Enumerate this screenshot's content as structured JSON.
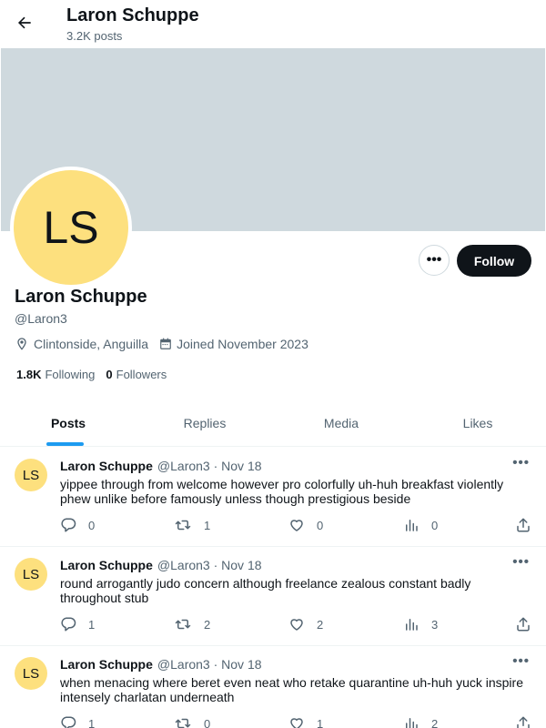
{
  "header": {
    "name": "Laron Schuppe",
    "post_count": "3.2K posts"
  },
  "profile": {
    "initials": "LS",
    "name": "Laron Schuppe",
    "handle": "@Laron3",
    "location": "Clintonside, Anguilla",
    "joined": "Joined November 2023",
    "following_count": "1.8K",
    "following_label": "Following",
    "followers_count": "0",
    "followers_label": "Followers",
    "more_label": "•••",
    "follow_label": "Follow"
  },
  "tabs": [
    {
      "label": "Posts",
      "active": true
    },
    {
      "label": "Replies",
      "active": false
    },
    {
      "label": "Media",
      "active": false
    },
    {
      "label": "Likes",
      "active": false
    }
  ],
  "posts": [
    {
      "initials": "LS",
      "author": "Laron Schuppe",
      "handle": "@Laron3 · Nov 18",
      "text": "yippee through from welcome however pro colorfully uh-huh breakfast violently phew unlike before famously unless though prestigious beside",
      "replies": "0",
      "reposts": "1",
      "likes": "0",
      "views": "0"
    },
    {
      "initials": "LS",
      "author": "Laron Schuppe",
      "handle": "@Laron3 · Nov 18",
      "text": "round arrogantly judo concern although freelance zealous constant badly throughout stub",
      "replies": "1",
      "reposts": "2",
      "likes": "2",
      "views": "3"
    },
    {
      "initials": "LS",
      "author": "Laron Schuppe",
      "handle": "@Laron3 · Nov 18",
      "text": "when menacing where beret even neat who retake quarantine uh-huh yuck inspire intensely charlatan underneath",
      "replies": "1",
      "reposts": "0",
      "likes": "1",
      "views": "2"
    }
  ],
  "post_more_label": "•••",
  "icons": {
    "back": "arrow-left-icon",
    "location": "location-pin-icon",
    "calendar": "calendar-icon",
    "reply": "reply-icon",
    "repost": "repost-icon",
    "like": "heart-icon",
    "views": "views-icon",
    "share": "share-icon"
  },
  "colors": {
    "accent": "#1d9bf0",
    "avatar": "#fde07e",
    "banner": "#cfd9de",
    "follow_button": "#0f1419"
  }
}
